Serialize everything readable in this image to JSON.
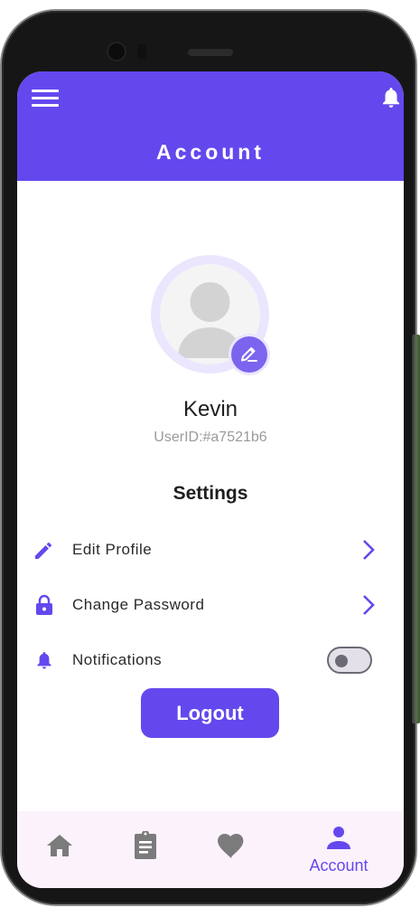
{
  "header": {
    "title": "Account",
    "menu_icon": "hamburger-menu-icon",
    "notification_icon": "bell-icon"
  },
  "profile": {
    "name": "Kevin",
    "user_id": "UserID:#a7521b6",
    "avatar_icon": "person-silhouette-icon",
    "edit_icon": "pencil-edit-icon"
  },
  "settings": {
    "heading": "Settings",
    "items": [
      {
        "label": "Edit Profile",
        "icon": "pencil-icon",
        "trailing": "chevron-right-icon"
      },
      {
        "label": "Change Password",
        "icon": "lock-icon",
        "trailing": "chevron-right-icon"
      },
      {
        "label": "Notifications",
        "icon": "bell-icon",
        "trailing": "toggle",
        "enabled": false
      }
    ]
  },
  "logout_label": "Logout",
  "bottom_nav": {
    "items": [
      {
        "icon": "home-icon",
        "label": "",
        "active": false
      },
      {
        "icon": "clipboard-icon",
        "label": "",
        "active": false
      },
      {
        "icon": "heart-icon",
        "label": "",
        "active": false
      },
      {
        "icon": "person-icon",
        "label": "Account",
        "active": true
      }
    ]
  },
  "colors": {
    "accent": "#6448ee",
    "nav_background": "#fcf2fb",
    "inactive_icon": "#7b7b7b"
  }
}
